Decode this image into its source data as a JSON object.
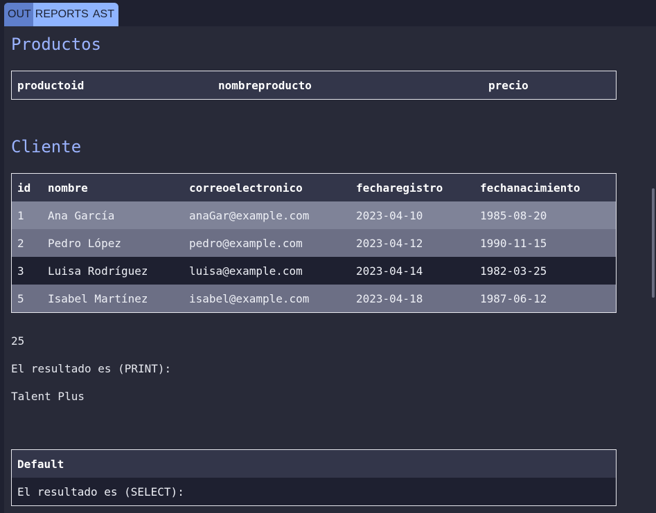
{
  "tabs": [
    {
      "label": "OUT"
    },
    {
      "label": "REPORTS"
    },
    {
      "label": "AST"
    }
  ],
  "productos": {
    "title": "Productos",
    "columns": [
      "productoid",
      "nombreproducto",
      "precio"
    ]
  },
  "cliente": {
    "title": "Cliente",
    "columns": [
      "id",
      "nombre",
      "correoelectronico",
      "fecharegistro",
      "fechanacimiento"
    ],
    "rows": [
      [
        "1",
        "Ana García",
        "anaGar@example.com",
        "2023-04-10",
        "1985-08-20"
      ],
      [
        "2",
        "Pedro López",
        "pedro@example.com",
        "2023-04-12",
        "1990-11-15"
      ],
      [
        "3",
        "Luisa Rodríguez",
        "luisa@example.com",
        "2023-04-14",
        "1982-03-25"
      ],
      [
        "5",
        "Isabel Martínez",
        "isabel@example.com",
        "2023-04-18",
        "1987-06-12"
      ]
    ]
  },
  "output": {
    "line1": "25",
    "line2": "El resultado es (PRINT):",
    "line3": "Talent Plus"
  },
  "default_table": {
    "header": "Default",
    "row": "El resultado es (SELECT):"
  }
}
